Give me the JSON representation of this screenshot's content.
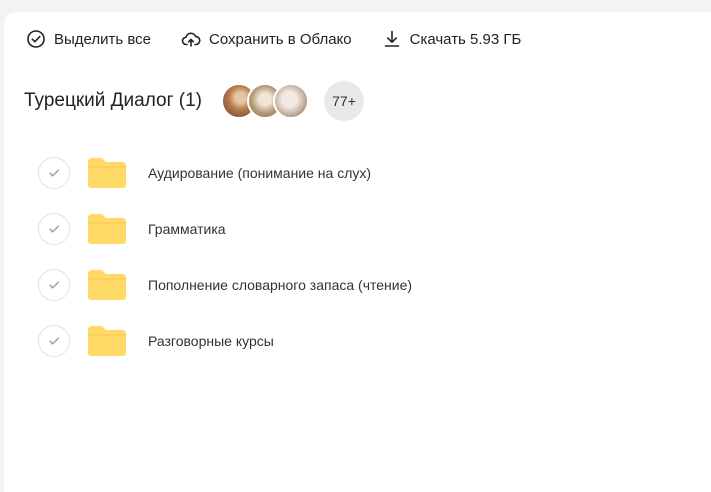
{
  "toolbar": {
    "select_all": "Выделить все",
    "save_cloud": "Сохранить в Облако",
    "download": "Скачать 5.93 ГБ"
  },
  "folder_header": {
    "title": "Турецкий Диалог (1)",
    "members_more": "77+"
  },
  "items": [
    {
      "label": "Аудирование (понимание на слух)"
    },
    {
      "label": "Грамматика"
    },
    {
      "label": "Пополнение словарного запаса (чтение)"
    },
    {
      "label": "Разговорные курсы"
    }
  ],
  "icons": {
    "select_all": "check-circle-icon",
    "save_cloud": "cloud-upload-icon",
    "download": "download-icon",
    "item_check": "checkmark-icon",
    "item_folder": "folder-icon"
  },
  "colors": {
    "folder": "#ffd966",
    "checkmark": "#9a9a9a",
    "badge_bg": "#e9e9ec"
  }
}
